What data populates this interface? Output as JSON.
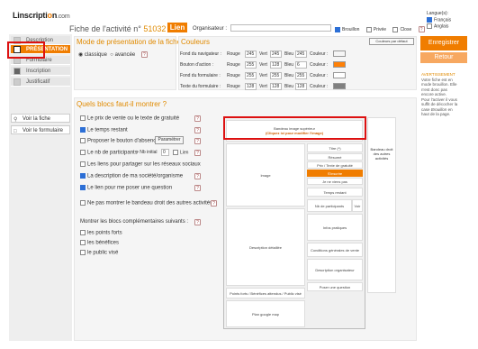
{
  "logo": {
    "brand": "Linscripti",
    "o": "o",
    "n": "n",
    "dot": ".com"
  },
  "header": {
    "title_prefix": "Fiche de l'activité n°",
    "number": "51032",
    "lien": "Lien",
    "organiser_label": "Organisateur :",
    "options": [
      "Brouillon",
      "Privée",
      "Close"
    ],
    "help": "?"
  },
  "langue": {
    "label": "Langue(s):",
    "items": [
      "Français",
      "Anglais"
    ]
  },
  "sidebar": {
    "items": [
      {
        "label": "Description",
        "active": false
      },
      {
        "label": "PRÉSENTATION",
        "active": true
      },
      {
        "label": "Formulaire",
        "active": false
      },
      {
        "label": "Inscription",
        "active": false
      },
      {
        "label": "Justificatif",
        "active": false
      }
    ],
    "links": [
      "Voir la fiche",
      "Voir le formulaire"
    ]
  },
  "mode": {
    "title": "Mode de présentation de la fiche",
    "classique": "classique",
    "avancee": "avancée",
    "help": "?"
  },
  "couleurs": {
    "title": "Couleurs",
    "default_btn": "Couleurs par défaut",
    "labels": {
      "rouge": "Rouge",
      "vert": "Vert",
      "bleu": "Bleu",
      "couleur": "Couleur :"
    },
    "rows": [
      {
        "label": "Fond du navigateur :",
        "r": "245",
        "g": "245",
        "b": "245",
        "color": "#f5f5f5"
      },
      {
        "label": "Bouton d'action :",
        "r": "255",
        "g": "128",
        "b": "6",
        "color": "#ff8006"
      },
      {
        "label": "Fond du formulaire :",
        "r": "255",
        "g": "255",
        "b": "255",
        "color": "#ffffff"
      },
      {
        "label": "Texte du formulaire :",
        "r": "128",
        "g": "128",
        "b": "128",
        "color": "#808080"
      }
    ]
  },
  "actions": {
    "save": "Enregistrer",
    "back": "Retour"
  },
  "warning": {
    "title": "AVERTISSEMENT",
    "lines": [
      "Votre fiche est en",
      "mode brouillon. Elle",
      "n'est donc pas",
      "encore active.",
      "Pour l'activer il vous",
      "suffit de décocher la",
      "case",
      "Brouillon",
      "en",
      "haut de la page."
    ]
  },
  "blocs": {
    "title": "Quels blocs faut-il montrer ?",
    "items": [
      {
        "label": "Le prix de vente ou le texte de gratuité",
        "checked": false
      },
      {
        "label": "Le temps restant",
        "checked": true
      },
      {
        "label": "Proposer le bouton d'absence",
        "checked": false,
        "button": "Paramétrer"
      },
      {
        "label": "Le nb de participants",
        "checked": false,
        "extra": "> Nb initial",
        "val": "0",
        "lien": "Lien"
      },
      {
        "label": "Les liens pour partager sur les réseaux sociaux",
        "checked": false
      },
      {
        "label": "La description de ma société/organisme",
        "checked": true
      },
      {
        "label": "Le lien pour me poser une question",
        "checked": true
      },
      {
        "label": "Ne pas montrer le bandeau droit des autres activités",
        "checked": false
      }
    ],
    "extra_title": "Montrer les blocs complémentaires suivants :",
    "extra_items": [
      "les points forts",
      "les bénéfices",
      "le public visé"
    ]
  },
  "diagram": {
    "banner_line1": "Bandeau image supérieur",
    "banner_line2": "(Cliquez ici pour modifier l'image)",
    "image": "Image",
    "titre": "Titre (*)",
    "resume": "Résumé",
    "prix": "Prix / Texte de gratuité",
    "inscrire": "S'inscrire",
    "absent": "Je ne viens pas",
    "temps": "Temps restant",
    "nb": "Nb de participants",
    "voir": "Voir",
    "right": "Bandeau droit des autres activités",
    "desc": "Description détaillée",
    "infos": "Infos pratiques",
    "cgv": "Conditions générales de vente",
    "desc_org": "Description organisateur",
    "question": "Poser une question",
    "points": "Points forts / Bénéfices attendus / Public visé",
    "map": "Plan google map"
  }
}
